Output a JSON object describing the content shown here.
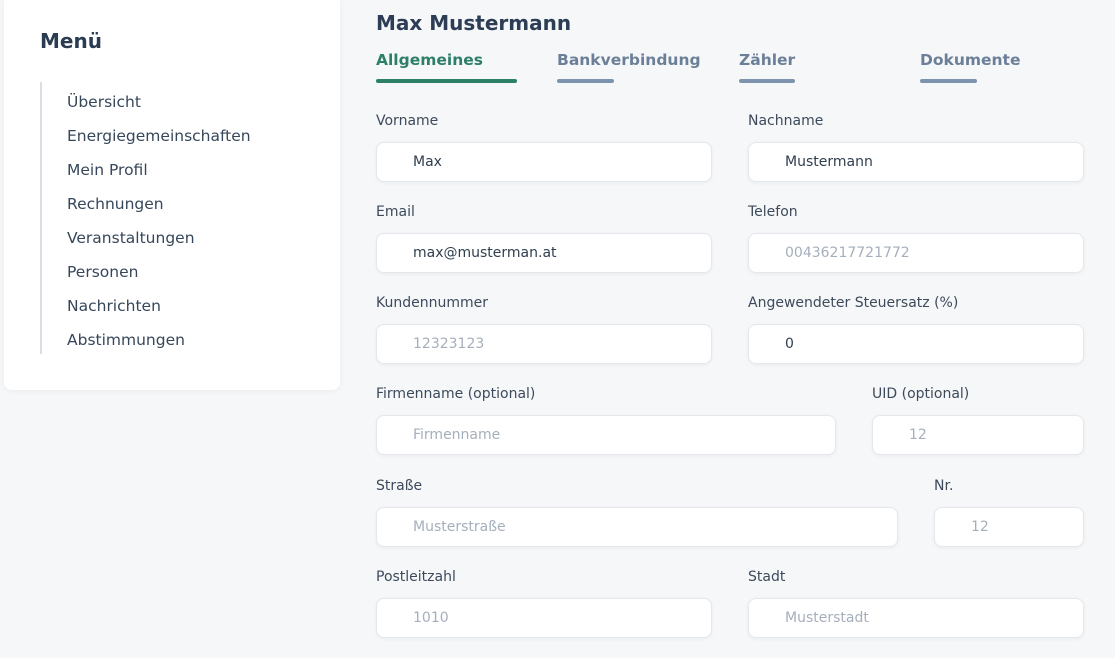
{
  "sidebar": {
    "title": "Menü",
    "items": [
      {
        "label": "Übersicht"
      },
      {
        "label": "Energiegemeinschaften"
      },
      {
        "label": "Mein Profil"
      },
      {
        "label": "Rechnungen"
      },
      {
        "label": "Veranstaltungen"
      },
      {
        "label": "Personen"
      },
      {
        "label": "Nachrichten"
      },
      {
        "label": "Abstimmungen"
      }
    ]
  },
  "main": {
    "title": "Max Mustermann",
    "tabs": [
      {
        "label": "Allgemeines",
        "active": true
      },
      {
        "label": "Bankverbindung",
        "active": false
      },
      {
        "label": "Zähler",
        "active": false
      },
      {
        "label": "Dokumente",
        "active": false
      }
    ],
    "fields": {
      "vorname": {
        "label": "Vorname",
        "value": "Max",
        "placeholder": ""
      },
      "nachname": {
        "label": "Nachname",
        "value": "Mustermann",
        "placeholder": ""
      },
      "email": {
        "label": "Email",
        "value": "max@musterman.at",
        "placeholder": ""
      },
      "telefon": {
        "label": "Telefon",
        "value": "",
        "placeholder": "00436217721772"
      },
      "kundennummer": {
        "label": "Kundennummer",
        "value": "",
        "placeholder": "12323123"
      },
      "steuersatz": {
        "label": "Angewendeter Steuersatz (%)",
        "value": "0",
        "placeholder": ""
      },
      "firmenname": {
        "label": "Firmenname (optional)",
        "value": "",
        "placeholder": "Firmenname"
      },
      "uid": {
        "label": "UID (optional)",
        "value": "",
        "placeholder": "12"
      },
      "strasse": {
        "label": "Straße",
        "value": "",
        "placeholder": "Musterstraße"
      },
      "nr": {
        "label": "Nr.",
        "value": "",
        "placeholder": "12"
      },
      "postleitzahl": {
        "label": "Postleitzahl",
        "value": "",
        "placeholder": "1010"
      },
      "stadt": {
        "label": "Stadt",
        "value": "",
        "placeholder": "Musterstadt"
      }
    }
  },
  "colors": {
    "accent": "#2d7f68",
    "tab_inactive": "#6b7f98",
    "background": "#f6f7f8"
  }
}
